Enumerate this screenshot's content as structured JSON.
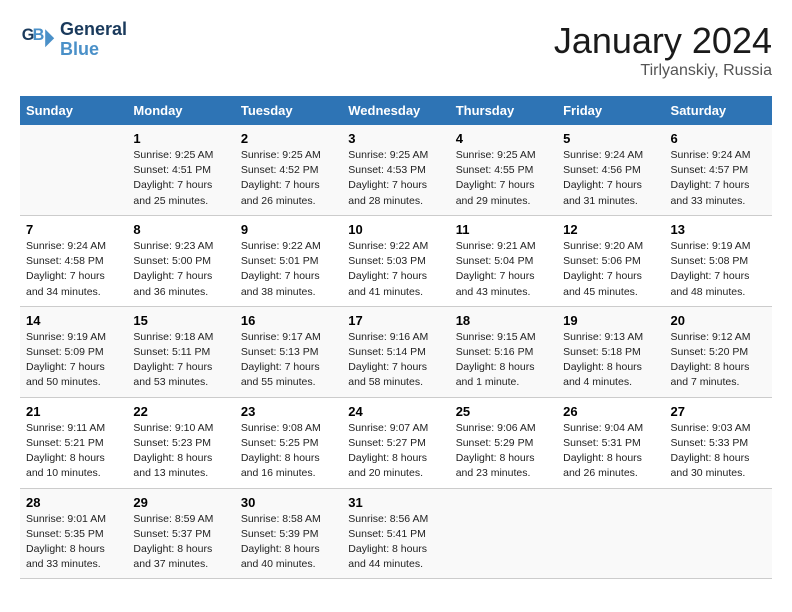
{
  "logo": {
    "line1": "General",
    "line2": "Blue"
  },
  "title": "January 2024",
  "subtitle": "Tirlyanskiy, Russia",
  "days_header": [
    "Sunday",
    "Monday",
    "Tuesday",
    "Wednesday",
    "Thursday",
    "Friday",
    "Saturday"
  ],
  "weeks": [
    [
      {
        "num": "",
        "sunrise": "",
        "sunset": "",
        "daylight": ""
      },
      {
        "num": "1",
        "sunrise": "Sunrise: 9:25 AM",
        "sunset": "Sunset: 4:51 PM",
        "daylight": "Daylight: 7 hours and 25 minutes."
      },
      {
        "num": "2",
        "sunrise": "Sunrise: 9:25 AM",
        "sunset": "Sunset: 4:52 PM",
        "daylight": "Daylight: 7 hours and 26 minutes."
      },
      {
        "num": "3",
        "sunrise": "Sunrise: 9:25 AM",
        "sunset": "Sunset: 4:53 PM",
        "daylight": "Daylight: 7 hours and 28 minutes."
      },
      {
        "num": "4",
        "sunrise": "Sunrise: 9:25 AM",
        "sunset": "Sunset: 4:55 PM",
        "daylight": "Daylight: 7 hours and 29 minutes."
      },
      {
        "num": "5",
        "sunrise": "Sunrise: 9:24 AM",
        "sunset": "Sunset: 4:56 PM",
        "daylight": "Daylight: 7 hours and 31 minutes."
      },
      {
        "num": "6",
        "sunrise": "Sunrise: 9:24 AM",
        "sunset": "Sunset: 4:57 PM",
        "daylight": "Daylight: 7 hours and 33 minutes."
      }
    ],
    [
      {
        "num": "7",
        "sunrise": "Sunrise: 9:24 AM",
        "sunset": "Sunset: 4:58 PM",
        "daylight": "Daylight: 7 hours and 34 minutes."
      },
      {
        "num": "8",
        "sunrise": "Sunrise: 9:23 AM",
        "sunset": "Sunset: 5:00 PM",
        "daylight": "Daylight: 7 hours and 36 minutes."
      },
      {
        "num": "9",
        "sunrise": "Sunrise: 9:22 AM",
        "sunset": "Sunset: 5:01 PM",
        "daylight": "Daylight: 7 hours and 38 minutes."
      },
      {
        "num": "10",
        "sunrise": "Sunrise: 9:22 AM",
        "sunset": "Sunset: 5:03 PM",
        "daylight": "Daylight: 7 hours and 41 minutes."
      },
      {
        "num": "11",
        "sunrise": "Sunrise: 9:21 AM",
        "sunset": "Sunset: 5:04 PM",
        "daylight": "Daylight: 7 hours and 43 minutes."
      },
      {
        "num": "12",
        "sunrise": "Sunrise: 9:20 AM",
        "sunset": "Sunset: 5:06 PM",
        "daylight": "Daylight: 7 hours and 45 minutes."
      },
      {
        "num": "13",
        "sunrise": "Sunrise: 9:19 AM",
        "sunset": "Sunset: 5:08 PM",
        "daylight": "Daylight: 7 hours and 48 minutes."
      }
    ],
    [
      {
        "num": "14",
        "sunrise": "Sunrise: 9:19 AM",
        "sunset": "Sunset: 5:09 PM",
        "daylight": "Daylight: 7 hours and 50 minutes."
      },
      {
        "num": "15",
        "sunrise": "Sunrise: 9:18 AM",
        "sunset": "Sunset: 5:11 PM",
        "daylight": "Daylight: 7 hours and 53 minutes."
      },
      {
        "num": "16",
        "sunrise": "Sunrise: 9:17 AM",
        "sunset": "Sunset: 5:13 PM",
        "daylight": "Daylight: 7 hours and 55 minutes."
      },
      {
        "num": "17",
        "sunrise": "Sunrise: 9:16 AM",
        "sunset": "Sunset: 5:14 PM",
        "daylight": "Daylight: 7 hours and 58 minutes."
      },
      {
        "num": "18",
        "sunrise": "Sunrise: 9:15 AM",
        "sunset": "Sunset: 5:16 PM",
        "daylight": "Daylight: 8 hours and 1 minute."
      },
      {
        "num": "19",
        "sunrise": "Sunrise: 9:13 AM",
        "sunset": "Sunset: 5:18 PM",
        "daylight": "Daylight: 8 hours and 4 minutes."
      },
      {
        "num": "20",
        "sunrise": "Sunrise: 9:12 AM",
        "sunset": "Sunset: 5:20 PM",
        "daylight": "Daylight: 8 hours and 7 minutes."
      }
    ],
    [
      {
        "num": "21",
        "sunrise": "Sunrise: 9:11 AM",
        "sunset": "Sunset: 5:21 PM",
        "daylight": "Daylight: 8 hours and 10 minutes."
      },
      {
        "num": "22",
        "sunrise": "Sunrise: 9:10 AM",
        "sunset": "Sunset: 5:23 PM",
        "daylight": "Daylight: 8 hours and 13 minutes."
      },
      {
        "num": "23",
        "sunrise": "Sunrise: 9:08 AM",
        "sunset": "Sunset: 5:25 PM",
        "daylight": "Daylight: 8 hours and 16 minutes."
      },
      {
        "num": "24",
        "sunrise": "Sunrise: 9:07 AM",
        "sunset": "Sunset: 5:27 PM",
        "daylight": "Daylight: 8 hours and 20 minutes."
      },
      {
        "num": "25",
        "sunrise": "Sunrise: 9:06 AM",
        "sunset": "Sunset: 5:29 PM",
        "daylight": "Daylight: 8 hours and 23 minutes."
      },
      {
        "num": "26",
        "sunrise": "Sunrise: 9:04 AM",
        "sunset": "Sunset: 5:31 PM",
        "daylight": "Daylight: 8 hours and 26 minutes."
      },
      {
        "num": "27",
        "sunrise": "Sunrise: 9:03 AM",
        "sunset": "Sunset: 5:33 PM",
        "daylight": "Daylight: 8 hours and 30 minutes."
      }
    ],
    [
      {
        "num": "28",
        "sunrise": "Sunrise: 9:01 AM",
        "sunset": "Sunset: 5:35 PM",
        "daylight": "Daylight: 8 hours and 33 minutes."
      },
      {
        "num": "29",
        "sunrise": "Sunrise: 8:59 AM",
        "sunset": "Sunset: 5:37 PM",
        "daylight": "Daylight: 8 hours and 37 minutes."
      },
      {
        "num": "30",
        "sunrise": "Sunrise: 8:58 AM",
        "sunset": "Sunset: 5:39 PM",
        "daylight": "Daylight: 8 hours and 40 minutes."
      },
      {
        "num": "31",
        "sunrise": "Sunrise: 8:56 AM",
        "sunset": "Sunset: 5:41 PM",
        "daylight": "Daylight: 8 hours and 44 minutes."
      },
      {
        "num": "",
        "sunrise": "",
        "sunset": "",
        "daylight": ""
      },
      {
        "num": "",
        "sunrise": "",
        "sunset": "",
        "daylight": ""
      },
      {
        "num": "",
        "sunrise": "",
        "sunset": "",
        "daylight": ""
      }
    ]
  ]
}
